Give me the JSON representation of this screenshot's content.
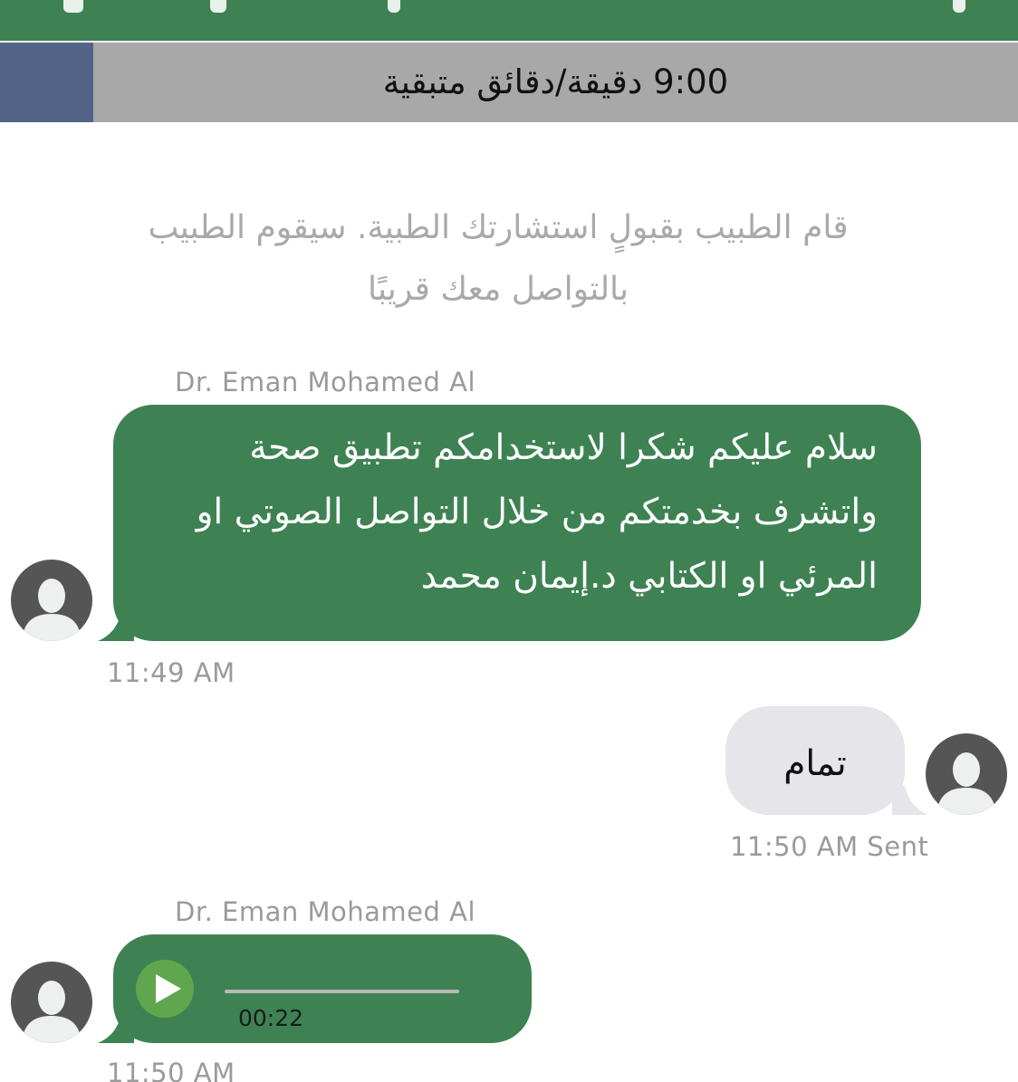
{
  "header": {
    "timer_text": "9:00 دقيقة/دقائق متبقية",
    "accent_color": "#3e8254",
    "timer_bar_color": "#546489",
    "timer_bg_color": "#a8a8a8"
  },
  "system_message": "قام الطبيب بقبولٍ استشارتك الطبية. سيقوم الطبيب بالتواصل معك قريبًا",
  "messages": [
    {
      "type": "incoming-text",
      "sender": "Dr. Eman Mohamed Al",
      "lines": [
        "سلام عليكم شكرا لاستخدامكم تطبيق صحة",
        "واتشرف بخدمتكم من خلال التواصل الصوتي او",
        "المرئي او الكتابي د.إيمان محمد"
      ],
      "time": "11:49 AM",
      "avatar_icon": "user-silhouette-icon"
    },
    {
      "type": "outgoing-text",
      "text": "تمام",
      "time": "11:50 AM Sent",
      "avatar_icon": "user-silhouette-icon"
    },
    {
      "type": "incoming-audio",
      "sender": "Dr. Eman Mohamed Al",
      "duration": "00:22",
      "time": "11:50 AM",
      "play_icon": "play-icon",
      "avatar_icon": "user-silhouette-icon"
    }
  ]
}
